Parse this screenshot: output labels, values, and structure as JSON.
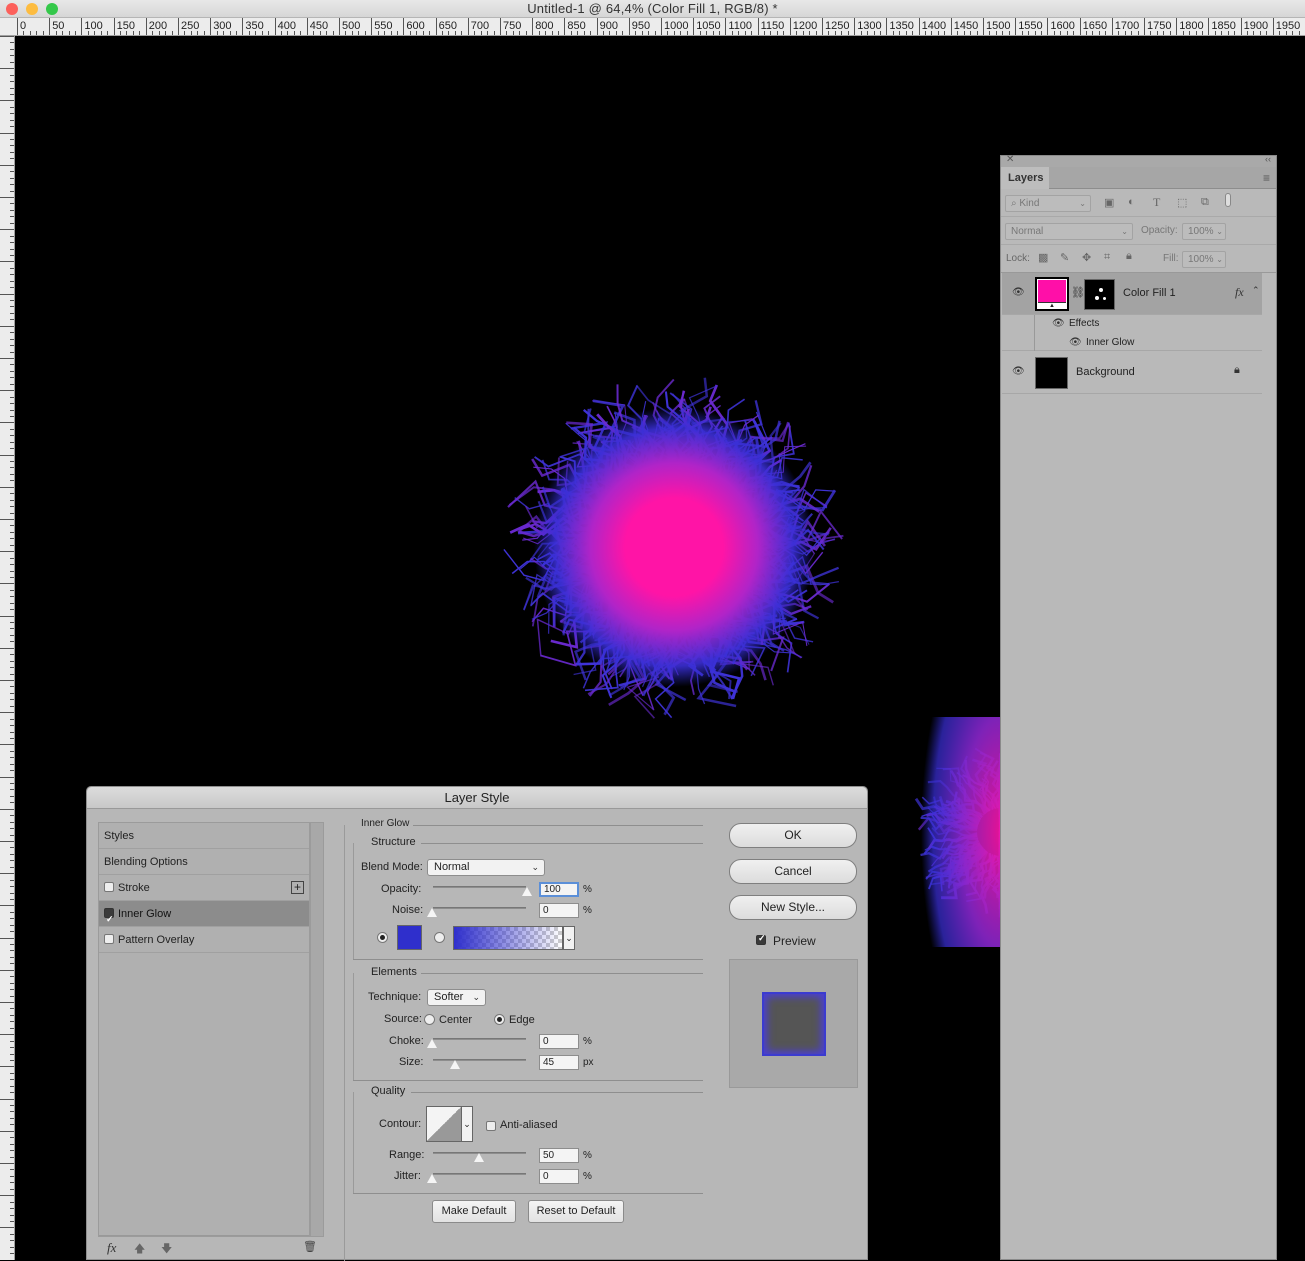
{
  "window": {
    "title": "Untitled-1 @ 64,4% (Color Fill 1, RGB/8) *",
    "traffic_lights": {
      "close_color": "#fc605b",
      "minimize_color": "#fdbc40",
      "zoom_color": "#34c84a"
    }
  },
  "ruler": {
    "top_labels": [
      "0",
      "50",
      "100",
      "150",
      "200",
      "250",
      "300",
      "350",
      "400",
      "450",
      "500",
      "550",
      "600",
      "650",
      "700",
      "750",
      "800",
      "850",
      "900",
      "950",
      "1000",
      "1050",
      "1100",
      "1150",
      "1200",
      "1250",
      "1300",
      "1350",
      "1400",
      "1450",
      "1500",
      "1550",
      "1600",
      "1650",
      "1700",
      "1750",
      "1800",
      "1850",
      "1900",
      "1950"
    ]
  },
  "canvas": {
    "background": "#000000",
    "glow_core_color": "#ff1aa8",
    "glow_edge_color": "#3a2fd6"
  },
  "layers_panel": {
    "tab_label": "Layers",
    "filter": {
      "kind_label": "Kind"
    },
    "blend_mode": "Normal",
    "opacity_label": "Opacity:",
    "opacity_value": "100%",
    "lock_label": "Lock:",
    "fill_label": "Fill:",
    "fill_value": "100%",
    "layers": [
      {
        "name": "Color Fill 1",
        "thumb_color": "#ff0fa8",
        "fx": "fx"
      },
      {
        "name": "Background",
        "thumb_color": "#000000"
      }
    ],
    "effects_label": "Effects",
    "effect_name": "Inner Glow"
  },
  "dialog": {
    "title": "Layer Style",
    "styles_list": [
      "Styles",
      "Blending Options",
      "Stroke",
      "Inner Glow",
      "Pattern Overlay"
    ],
    "inner_glow": {
      "section_title": "Inner Glow",
      "structure_title": "Structure",
      "blend_mode_label": "Blend Mode:",
      "blend_mode_value": "Normal",
      "opacity_label": "Opacity:",
      "opacity_value": "100",
      "opacity_unit": "%",
      "noise_label": "Noise:",
      "noise_value": "0",
      "noise_unit": "%",
      "glow_color": "#2f2fcc",
      "elements_title": "Elements",
      "technique_label": "Technique:",
      "technique_value": "Softer",
      "source_label": "Source:",
      "source_center": "Center",
      "source_edge": "Edge",
      "choke_label": "Choke:",
      "choke_value": "0",
      "choke_unit": "%",
      "size_label": "Size:",
      "size_value": "45",
      "size_unit": "px",
      "quality_title": "Quality",
      "contour_label": "Contour:",
      "anti_aliased_label": "Anti-aliased",
      "range_label": "Range:",
      "range_value": "50",
      "range_unit": "%",
      "jitter_label": "Jitter:",
      "jitter_value": "0",
      "jitter_unit": "%",
      "make_default": "Make Default",
      "reset_default": "Reset to Default"
    },
    "buttons": {
      "ok": "OK",
      "cancel": "Cancel",
      "new_style": "New Style..."
    },
    "preview_label": "Preview"
  }
}
